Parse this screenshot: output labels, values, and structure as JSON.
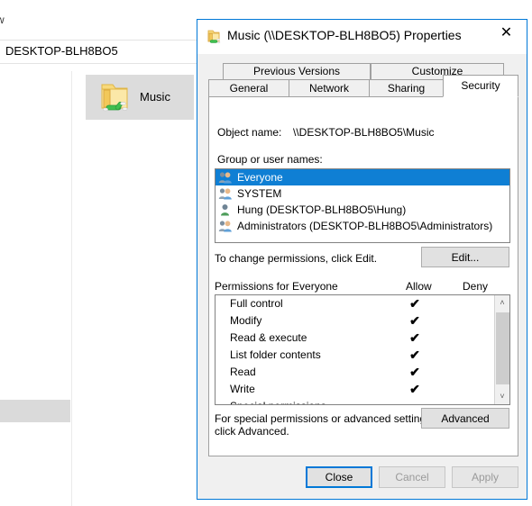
{
  "explorer": {
    "menu_fragment": "w",
    "address_value": "DESKTOP-BLH8BO5",
    "folder_item": {
      "label": "Music",
      "icon": "shared-folder-icon"
    }
  },
  "dialog": {
    "title": "Music (\\\\DESKTOP-BLH8BO5) Properties",
    "title_icon": "shared-folder-icon",
    "close_icon": "✕",
    "accent_color": "#0078d7",
    "tabs_top": [
      {
        "label": "Previous Versions",
        "active": false
      },
      {
        "label": "Customize",
        "active": false
      }
    ],
    "tabs_bottom": [
      {
        "label": "General",
        "active": false
      },
      {
        "label": "Network",
        "active": false
      },
      {
        "label": "Sharing",
        "active": false
      },
      {
        "label": "Security",
        "active": true
      }
    ],
    "security": {
      "object_name_label": "Object name:",
      "object_name_value": "\\\\DESKTOP-BLH8BO5\\Music",
      "group_names_label": "Group or user names:",
      "groups": [
        {
          "name": "Everyone",
          "icon": "users-group-icon",
          "selected": true
        },
        {
          "name": "SYSTEM",
          "icon": "users-group-icon",
          "selected": false
        },
        {
          "name": "Hung (DESKTOP-BLH8BO5\\Hung)",
          "icon": "user-icon",
          "selected": false
        },
        {
          "name": "Administrators (DESKTOP-BLH8BO5\\Administrators)",
          "icon": "users-group-icon",
          "selected": false
        }
      ],
      "selection_color": "#0f7fd4",
      "change_permissions_text": "To change permissions, click Edit.",
      "edit_button_label": "Edit...",
      "permissions_header": "Permissions for Everyone",
      "allow_column_header": "Allow",
      "deny_column_header": "Deny",
      "check_glyph": "✔",
      "permissions": [
        {
          "name": "Full control",
          "allow": true,
          "deny": false
        },
        {
          "name": "Modify",
          "allow": true,
          "deny": false
        },
        {
          "name": "Read & execute",
          "allow": true,
          "deny": false
        },
        {
          "name": "List folder contents",
          "allow": true,
          "deny": false
        },
        {
          "name": "Read",
          "allow": true,
          "deny": false
        },
        {
          "name": "Write",
          "allow": true,
          "deny": false
        },
        {
          "name": "Special permissions",
          "allow": false,
          "deny": false
        }
      ],
      "scroll_up_glyph": "˄",
      "scroll_down_glyph": "˅",
      "special_text_line1": "For special permissions or advanced settings,",
      "special_text_line2": "click Advanced.",
      "advanced_button_label": "Advanced"
    },
    "footer": {
      "close_label": "Close",
      "cancel_label": "Cancel",
      "apply_label": "Apply",
      "cancel_disabled": true,
      "apply_disabled": true
    }
  }
}
